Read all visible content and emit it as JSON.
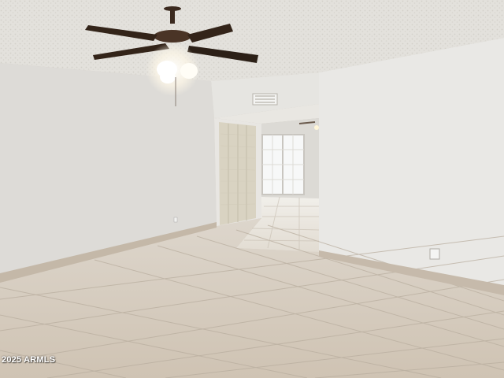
{
  "photo": {
    "subject": "empty-room-interior"
  },
  "watermark": {
    "text": "2025 ARMLS"
  },
  "colors": {
    "ceiling": "#e4e2dd",
    "wall_left": "#dcdad6",
    "wall_right": "#e8e7e4",
    "tile": "#d9cfc2",
    "grout": "#b8aea0",
    "baseboard": "#c2b6a7",
    "fan": "#3a2a20"
  }
}
